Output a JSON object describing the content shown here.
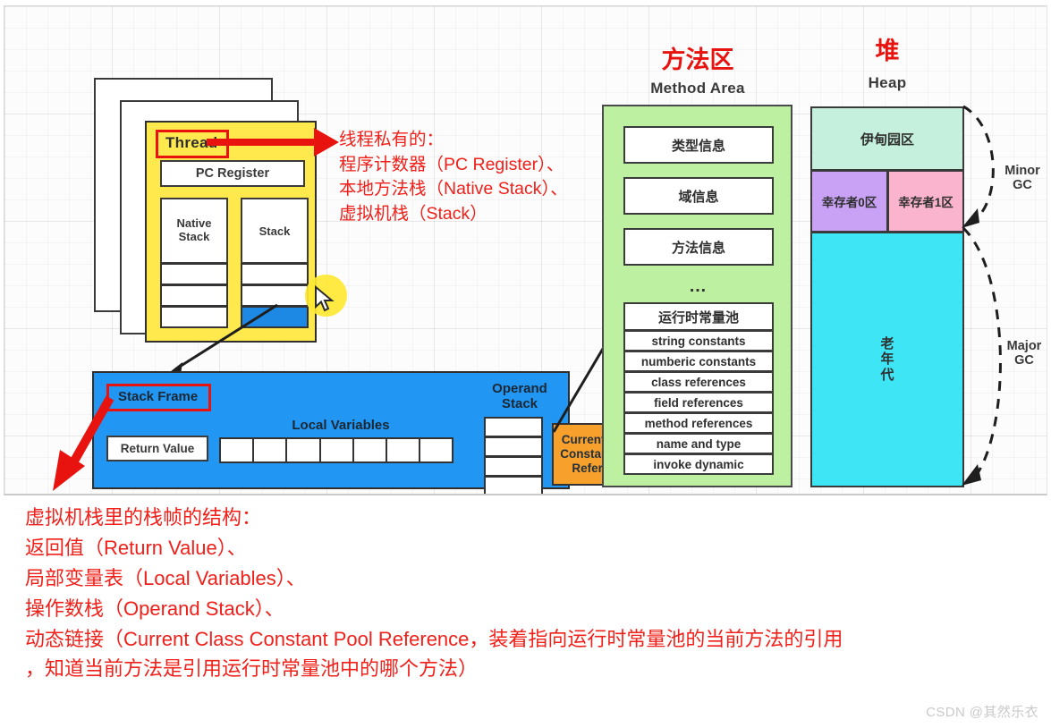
{
  "thread_panel": {
    "thread_label": "Thread",
    "pc_register": "PC Register",
    "native_stack": "Native\nStack",
    "native_stack_line1": "Native",
    "native_stack_line2": "Stack",
    "stack": "Stack"
  },
  "annotation_thread": {
    "line1": "线程私有的：",
    "line2": "程序计数器（PC Register）、",
    "line3": "本地方法栈（Native Stack）、",
    "line4": "虚拟机栈（Stack）"
  },
  "stack_frame": {
    "title": "Stack Frame",
    "return_value": "Return Value",
    "local_variables": "Local Variables",
    "operand_stack_line1": "Operand",
    "operand_stack_line2": "Stack",
    "constant_pool_ref_line1": "Current Class",
    "constant_pool_ref_line2": "Constant Pool",
    "constant_pool_ref_line3": "Reference",
    "local_variable_slots": 7,
    "operand_stack_slots": 4
  },
  "method_area": {
    "title_cn": "方法区",
    "title_en": "Method Area",
    "rows": [
      "类型信息",
      "域信息",
      "方法信息"
    ],
    "ellipsis": "…",
    "runtime_constant_pool": "运行时常量池",
    "pool_entries": [
      "string constants",
      "numberic constants",
      "class references",
      "field references",
      "method references",
      "name and type",
      "invoke dynamic"
    ]
  },
  "heap": {
    "title_cn": "堆",
    "title_en": "Heap",
    "eden": "伊甸园区",
    "survivor0": "幸存者0区",
    "survivor1": "幸存者1区",
    "old_gen": "老年代",
    "old_gen_chars": [
      "老",
      "年",
      "代"
    ],
    "minor_gc_line1": "Minor",
    "minor_gc_line2": "GC",
    "major_gc_line1": "Major",
    "major_gc_line2": "GC"
  },
  "bottom_note": {
    "line1": "虚拟机栈里的栈帧的结构：",
    "line2": "返回值（Return Value）、",
    "line3": "局部变量表（Local Variables）、",
    "line4": "操作数栈（Operand Stack）、",
    "line5": "动态链接（Current Class Constant Pool Reference，装着指向运行时常量池的当前方法的引用",
    "line6": "，知道当前方法是引用运行时常量池中的哪个方法）"
  },
  "watermark": "CSDN @其然乐衣",
  "colors": {
    "annotation_red": "#f0201a",
    "highlight_border_red": "#e8130f",
    "thread_yellow": "#ffe94d",
    "stack_frame_blue": "#2196f3",
    "stack_fill_blue": "#1e88e5",
    "method_area_green": "#bdf0a0",
    "constant_pool_orange": "#f7a02c",
    "eden_green": "#c4f0dd",
    "survivor0_purple": "#c9a2f5",
    "survivor1_pink": "#fbb4cd",
    "old_gen_cyan": "#3ee6f5",
    "cursor_yellow": "#ffe833"
  }
}
